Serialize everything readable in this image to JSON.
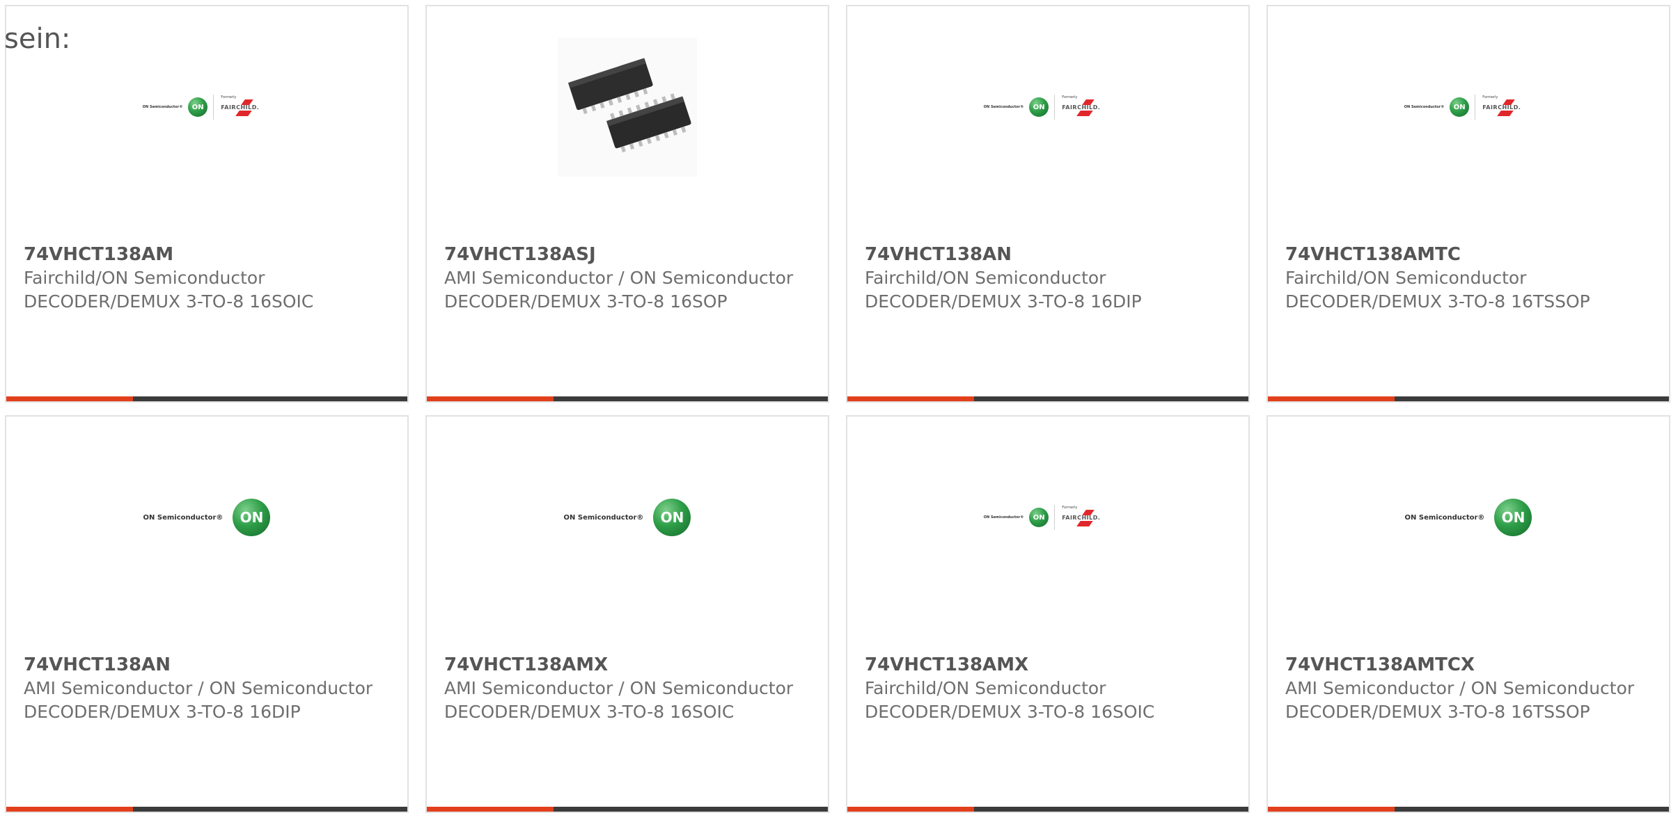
{
  "intro_text": "sein:",
  "colors": {
    "accent": "#e2401c",
    "bar": "#3b3b3b",
    "on_green": "#2e9e48",
    "fairchild_red": "#e0282c"
  },
  "cards": [
    {
      "part": "74VHCT138AM",
      "maker": "Fairchild/ON Semiconductor",
      "desc": "DECODER/DEMUX 3-TO-8 16SOIC",
      "image": "on-fairchild-logo",
      "logo": {
        "on_text": "ON Semiconductor®",
        "on_badge": "ON",
        "formerly": "Formerly",
        "fairchild": "FAIRCHILD."
      }
    },
    {
      "part": "74VHCT138ASJ",
      "maker": "AMI Semiconductor / ON Semiconductor",
      "desc": "DECODER/DEMUX 3-TO-8 16SOP",
      "image": "chip-photo"
    },
    {
      "part": "74VHCT138AN",
      "maker": "Fairchild/ON Semiconductor",
      "desc": "DECODER/DEMUX 3-TO-8 16DIP",
      "image": "on-fairchild-logo",
      "logo": {
        "on_text": "ON Semiconductor®",
        "on_badge": "ON",
        "formerly": "Formerly",
        "fairchild": "FAIRCHILD."
      }
    },
    {
      "part": "74VHCT138AMTC",
      "maker": "Fairchild/ON Semiconductor",
      "desc": "DECODER/DEMUX 3-TO-8 16TSSOP",
      "image": "on-fairchild-logo",
      "logo": {
        "on_text": "ON Semiconductor®",
        "on_badge": "ON",
        "formerly": "Formerly",
        "fairchild": "FAIRCHILD."
      }
    },
    {
      "part": "74VHCT138AN",
      "maker": "AMI Semiconductor / ON Semiconductor",
      "desc": "DECODER/DEMUX 3-TO-8 16DIP",
      "image": "on-logo",
      "logo": {
        "on_text": "ON Semiconductor®",
        "on_badge": "ON"
      }
    },
    {
      "part": "74VHCT138AMX",
      "maker": "AMI Semiconductor / ON Semiconductor",
      "desc": "DECODER/DEMUX 3-TO-8 16SOIC",
      "image": "on-logo",
      "logo": {
        "on_text": "ON Semiconductor®",
        "on_badge": "ON"
      }
    },
    {
      "part": "74VHCT138AMX",
      "maker": "Fairchild/ON Semiconductor",
      "desc": "DECODER/DEMUX 3-TO-8 16SOIC",
      "image": "on-fairchild-logo",
      "logo": {
        "on_text": "ON Semiconductor®",
        "on_badge": "ON",
        "formerly": "Formerly",
        "fairchild": "FAIRCHILD."
      }
    },
    {
      "part": "74VHCT138AMTCX",
      "maker": "AMI Semiconductor / ON Semiconductor",
      "desc": "DECODER/DEMUX 3-TO-8 16TSSOP",
      "image": "on-logo",
      "logo": {
        "on_text": "ON Semiconductor®",
        "on_badge": "ON"
      }
    }
  ]
}
